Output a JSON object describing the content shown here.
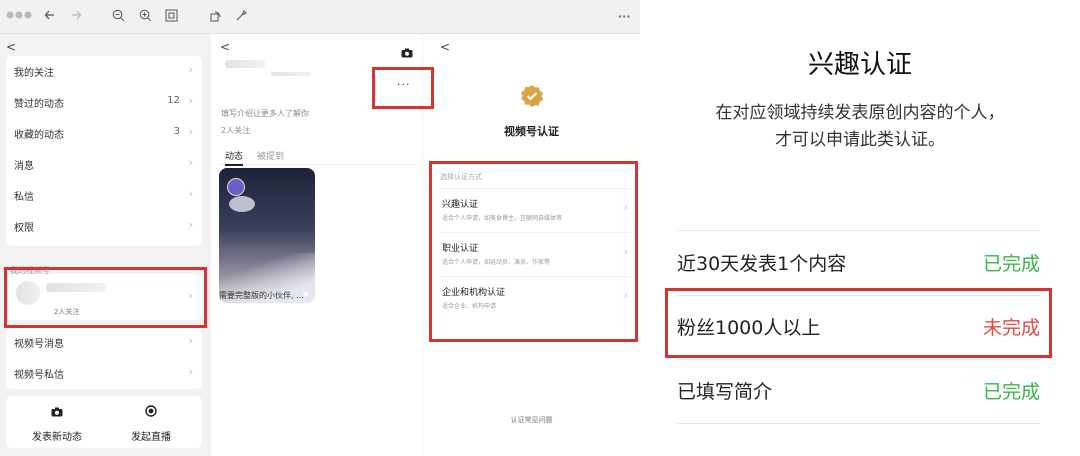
{
  "colors": {
    "highlight": "#d63334",
    "complete": "#3ab54a",
    "incomplete": "#e04a47",
    "badge_gold": "#d9a441"
  },
  "toolbar": {
    "icons": [
      "window-controls",
      "back-icon",
      "forward-icon",
      "zoom-out-icon",
      "zoom-in-icon",
      "fit-icon",
      "rotate-icon",
      "tools-icon",
      "more-icon"
    ],
    "more": "···"
  },
  "profile_panel": {
    "back": "<",
    "items": [
      {
        "label": "我的关注",
        "count": ""
      },
      {
        "label": "赞过的动态",
        "count": "12"
      },
      {
        "label": "收藏的动态",
        "count": "3"
      },
      {
        "label": "消息",
        "count": ""
      },
      {
        "label": "私信",
        "count": ""
      },
      {
        "label": "权限",
        "count": ""
      }
    ],
    "section_label": "我的视频号",
    "channel_followers": "2人关注",
    "channel_items": [
      {
        "label": "视频号消息"
      },
      {
        "label": "视频号私信"
      }
    ],
    "actions": [
      {
        "label": "发表新动态",
        "icon": "camera-icon"
      },
      {
        "label": "发起直播",
        "icon": "live-icon"
      }
    ]
  },
  "channel_panel": {
    "back": "<",
    "more": "···",
    "intro": "填写介绍让更多人了解你",
    "followers": "2人关注",
    "tabs": [
      "动态",
      "被提到"
    ],
    "video_caption": "需要完整版的小伙伴, ..."
  },
  "verify_panel": {
    "back": "<",
    "title": "视频号认证",
    "hint": "选择认证方式",
    "options": [
      {
        "title": "兴趣认证",
        "desc": "适合个人申请，如美食博主、互联网自媒体等"
      },
      {
        "title": "职业认证",
        "desc": "适合个人申请，如运动员、演员、作家等"
      },
      {
        "title": "企业和机构认证",
        "desc": "适合企业、机构申请"
      }
    ],
    "faq": "认证常见问题"
  },
  "interest_verification": {
    "title": "兴趣认证",
    "description": [
      "在对应领域持续发表原创内容的个人，",
      "才可以申请此类认证。"
    ],
    "requirements": [
      {
        "label": "近30天发表1个内容",
        "status": "已完成",
        "done": true
      },
      {
        "label": "粉丝1000人以上",
        "status": "未完成",
        "done": false
      },
      {
        "label": "已填写简介",
        "status": "已完成",
        "done": true
      }
    ]
  }
}
